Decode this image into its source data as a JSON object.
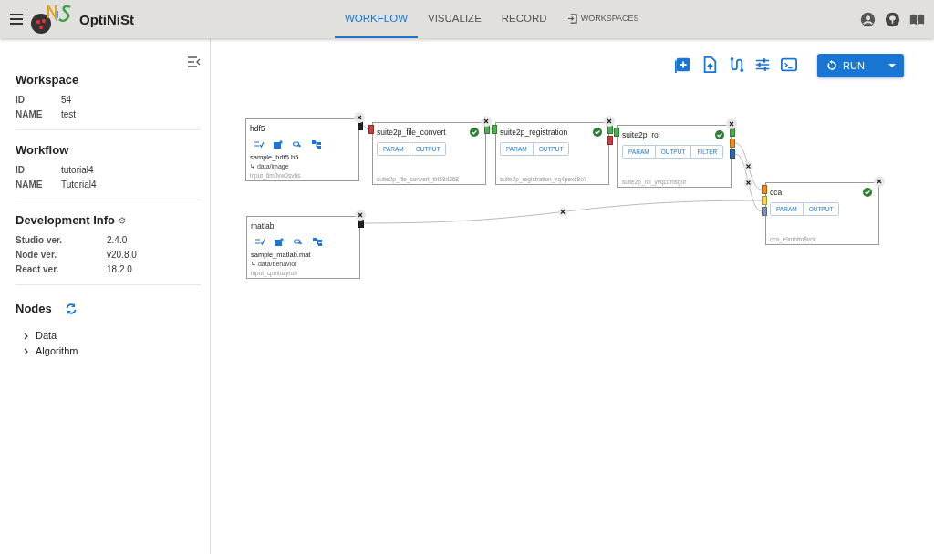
{
  "header": {
    "app_name": "OptiNiSt",
    "tabs": [
      {
        "label": "WORKFLOW",
        "selected": true,
        "kind": "plain"
      },
      {
        "label": "VISUALIZE",
        "selected": false,
        "kind": "plain"
      },
      {
        "label": "RECORD",
        "selected": false,
        "kind": "plain"
      },
      {
        "label": "WORKSPACES",
        "selected": false,
        "kind": "link"
      }
    ]
  },
  "sidebar": {
    "sections": [
      {
        "title": "Workspace",
        "kind": "pairs",
        "rows": [
          {
            "label": "ID",
            "value": "54"
          },
          {
            "label": "NAME",
            "value": "test"
          }
        ]
      },
      {
        "title": "Workflow",
        "kind": "pairs",
        "rows": [
          {
            "label": "ID",
            "value": "tutorial4"
          },
          {
            "label": "NAME",
            "value": "Tutorial4"
          }
        ]
      },
      {
        "title": "Development Info",
        "kind": "info",
        "rows": [
          {
            "label": "Studio ver.",
            "value": "2.4.0"
          },
          {
            "label": "Node ver.",
            "value": "v20.8.0"
          },
          {
            "label": "React ver.",
            "value": "18.2.0"
          }
        ]
      }
    ],
    "nodes": {
      "title": "Nodes",
      "items": [
        {
          "label": "Data",
          "expanded": false
        },
        {
          "label": "Algorithm",
          "expanded": false
        }
      ]
    }
  },
  "toolbar": {
    "run_label": "RUN"
  },
  "flow": {
    "nodes": [
      {
        "kind": "data",
        "title": "hdf5",
        "file": "sample_hdf5.h5",
        "path": "↳ data/image",
        "id": "input_6m0vw0sv6s",
        "outputs": [
          {
            "color": "#222222"
          }
        ]
      },
      {
        "kind": "algorithm",
        "title": "suite2p_file_convert",
        "done": true,
        "buttons": [
          "PARAM",
          "OUTPUT"
        ],
        "id": "suite2p_file_convert_tlri58d268",
        "inputs": [
          {
            "color": "#d23b3b"
          }
        ],
        "outputs": [
          {
            "color": "#4caf50"
          }
        ]
      },
      {
        "kind": "algorithm",
        "title": "suite2p_registration",
        "done": true,
        "buttons": [
          "PARAM",
          "OUTPUT"
        ],
        "id": "suite2p_registration_xq4pexs8o7",
        "inputs": [
          {
            "color": "#4caf50"
          }
        ],
        "outputs": [
          {
            "color": "#4caf50"
          },
          {
            "color": "#d23b3b"
          }
        ]
      },
      {
        "kind": "algorithm",
        "title": "suite2p_roi",
        "done": true,
        "buttons": [
          "PARAM",
          "OUTPUT",
          "FILTER"
        ],
        "id": "suite2p_roi_yvqcdmsg0r",
        "inputs": [
          {
            "color": "#4caf50"
          }
        ],
        "outputs": [
          {
            "color": "#4caf50"
          },
          {
            "color": "#ef8c1a"
          },
          {
            "color": "#2f6bb3"
          }
        ]
      },
      {
        "kind": "algorithm",
        "title": "cca",
        "done": true,
        "buttons": [
          "PARAM",
          "OUTPUT"
        ],
        "id": "cca_e9mbfm8vck",
        "inputs": [
          {
            "color": "#ef8c1a"
          },
          {
            "color": "#f5d94a"
          },
          {
            "color": "#7f95b5"
          }
        ]
      },
      {
        "kind": "data",
        "title": "matlab",
        "file": "sample_matlab.mat",
        "path": "↳ data/behavior",
        "id": "input_cpmiuzyroh",
        "outputs": [
          {
            "color": "#222222"
          }
        ]
      }
    ]
  }
}
